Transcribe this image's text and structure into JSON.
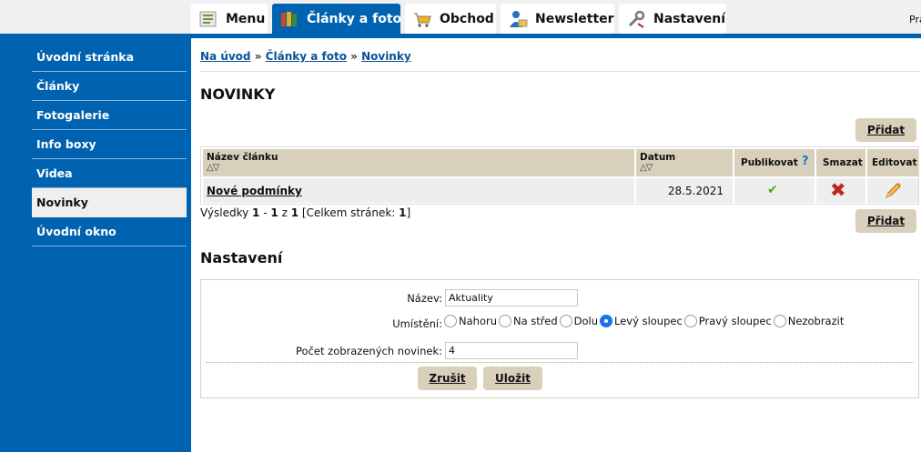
{
  "nav": {
    "tabs": [
      {
        "label": "Menu",
        "icon": "menu-list-icon"
      },
      {
        "label": "Články a foto",
        "icon": "books-icon",
        "active": true
      },
      {
        "label": "Obchod",
        "icon": "shopping-cart-icon"
      },
      {
        "label": "Newsletter",
        "icon": "user-mail-icon"
      },
      {
        "label": "Nastavení",
        "icon": "wrench-icon"
      }
    ],
    "right_text": "Pra"
  },
  "sidebar": {
    "items": [
      {
        "label": "Úvodní stránka"
      },
      {
        "label": "Články"
      },
      {
        "label": "Fotogalerie"
      },
      {
        "label": "Info boxy"
      },
      {
        "label": "Videa"
      },
      {
        "label": "Novinky",
        "active": true
      },
      {
        "label": "Úvodní okno"
      }
    ]
  },
  "breadcrumb": {
    "home": "Na úvod",
    "section": "Články a foto",
    "current": "Novinky",
    "separator": "»"
  },
  "page": {
    "title": "NOVINKY",
    "add_label": "Přidat"
  },
  "table": {
    "headers": {
      "name": "Název článku",
      "date": "Datum",
      "published": "Publikovat",
      "help": "?",
      "delete": "Smazat",
      "edit": "Editovat"
    },
    "sort_arrows": "△▽",
    "rows": [
      {
        "name": "Nové podmínky",
        "date": "28.5.2021",
        "published": "✔",
        "delete": "✖"
      }
    ]
  },
  "results": {
    "prefix": "Výsledky",
    "from": "1",
    "dash": "-",
    "to": "1",
    "of_word": "z",
    "total": "1",
    "pages_prefix": "[Celkem stránek:",
    "pages": "1",
    "pages_suffix": "]"
  },
  "settings": {
    "title": "Nastavení",
    "name_label": "Název:",
    "name_value": "Aktuality",
    "placement_label": "Umístění:",
    "placement_options": [
      "Nahoru",
      "Na střed",
      "Dolu",
      "Levý sloupec",
      "Pravý sloupec",
      "Nezobrazit"
    ],
    "placement_selected": "Levý sloupec",
    "count_label": "Počet zobrazených novinek:",
    "count_value": "4",
    "cancel_label": "Zrušit",
    "save_label": "Uložit"
  },
  "colors": {
    "brand_blue": "#0063b1",
    "button_beige": "#d9d0bc",
    "link_blue": "#0a5296",
    "check_green": "#5aa51e",
    "delete_red": "#c0281e"
  }
}
